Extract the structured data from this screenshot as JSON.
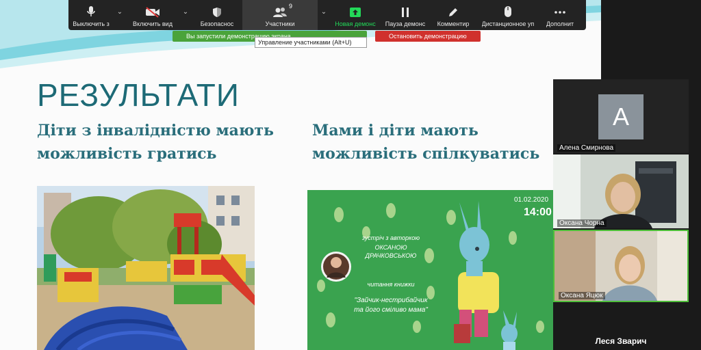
{
  "toolbar": {
    "items": [
      {
        "label": "Выключить з",
        "icon": "microphone-icon"
      },
      {
        "label": "Включить вид",
        "icon": "video-off-icon"
      },
      {
        "label": "Безопаснос",
        "icon": "shield-icon"
      },
      {
        "label": "Участники",
        "icon": "participants-icon",
        "count": "9"
      },
      {
        "label": "Новая демонс",
        "icon": "share-screen-icon"
      },
      {
        "label": "Пауза демонс",
        "icon": "pause-icon"
      },
      {
        "label": "Комментир",
        "icon": "pencil-icon"
      },
      {
        "label": "Дистанционное уп",
        "icon": "mouse-icon"
      },
      {
        "label": "Дополнит",
        "icon": "more-icon"
      }
    ],
    "share_status": "Вы запустили демонстрацию экрана",
    "stop_share": "Остановить демонстрацию",
    "tooltip": "Управление участниками (Alt+U)",
    "colors": {
      "bar": "#232323",
      "share": "#4aa33a",
      "stop": "#d0312d",
      "accent_green": "#23d959"
    }
  },
  "slide": {
    "title": "РЕЗУЛЬТАТИ",
    "left_subtitle": "Діти з інвалідністю мають можливість гратись",
    "right_subtitle": "Мами і діти мають можливість спілкуватись",
    "poster": {
      "date": "01.02.2020",
      "time": "14:00",
      "line1": "зустріч з авторкою",
      "line2": "ОКСАНОЮ ДРАЧКОВСЬКОЮ",
      "line3": "читання книжки",
      "line4": "\"Зайчик-нестрибайчик",
      "line5": "та його сміливо мама\""
    },
    "colors": {
      "title": "#1d6a76",
      "poster_bg": "#3aa34f"
    }
  },
  "participants": [
    {
      "name": "Алена Смирнова",
      "initial": "A"
    },
    {
      "name": "Оксана Чорна"
    },
    {
      "name": "Оксана Яцюк"
    },
    {
      "name": "Леся Зварич"
    }
  ]
}
